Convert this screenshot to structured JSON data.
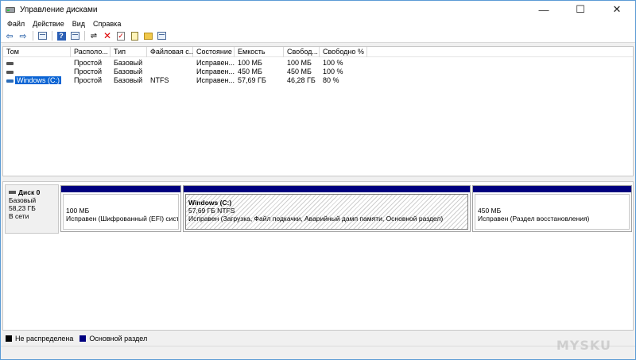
{
  "window": {
    "title": "Управление дисками",
    "controls": {
      "minimize": "—",
      "maximize": "☐",
      "close": "✕"
    }
  },
  "menu": {
    "file": "Файл",
    "action": "Действие",
    "view": "Вид",
    "help": "Справка"
  },
  "toolbar": {
    "icons": [
      "back-arrow-icon",
      "forward-arrow-icon",
      "console-tree-icon",
      "help-icon",
      "properties-icon",
      "connect-icon",
      "delete-icon",
      "check-icon",
      "new-icon",
      "open-icon",
      "export-icon"
    ]
  },
  "volume_list": {
    "columns": [
      "Том",
      "Располо...",
      "Тип",
      "Файловая с...",
      "Состояние",
      "Емкость",
      "Свобод...",
      "Свободно %"
    ],
    "rows": [
      {
        "volume": "",
        "layout": "Простой",
        "type": "Базовый",
        "fs": "",
        "status": "Исправен...",
        "capacity": "100 МБ",
        "free": "100 МБ",
        "free_pct": "100 %"
      },
      {
        "volume": "",
        "layout": "Простой",
        "type": "Базовый",
        "fs": "",
        "status": "Исправен...",
        "capacity": "450 МБ",
        "free": "450 МБ",
        "free_pct": "100 %"
      },
      {
        "volume": "Windows (C:)",
        "layout": "Простой",
        "type": "Базовый",
        "fs": "NTFS",
        "status": "Исправен...",
        "capacity": "57,69 ГБ",
        "free": "46,28 ГБ",
        "free_pct": "80 %"
      }
    ]
  },
  "disk0": {
    "name": "Диск 0",
    "type": "Базовый",
    "size": "58,23 ГБ",
    "status": "В сети",
    "partitions": [
      {
        "title": "",
        "size": "100 МБ",
        "status": "Исправен (Шифрованный (EFI) системный раздел)"
      },
      {
        "title": "Windows  (C:)",
        "size": "57,69 ГБ NTFS",
        "status": "Исправен (Загрузка, Файл подкачки, Аварийный дамп памяти, Основной раздел)"
      },
      {
        "title": "",
        "size": "450 МБ",
        "status": "Исправен (Раздел восстановления)"
      }
    ]
  },
  "legend": {
    "unallocated": "Не распределена",
    "primary": "Основной раздел",
    "unallocated_color": "#000000",
    "primary_color": "#00007f"
  },
  "watermark": "MYSKU"
}
